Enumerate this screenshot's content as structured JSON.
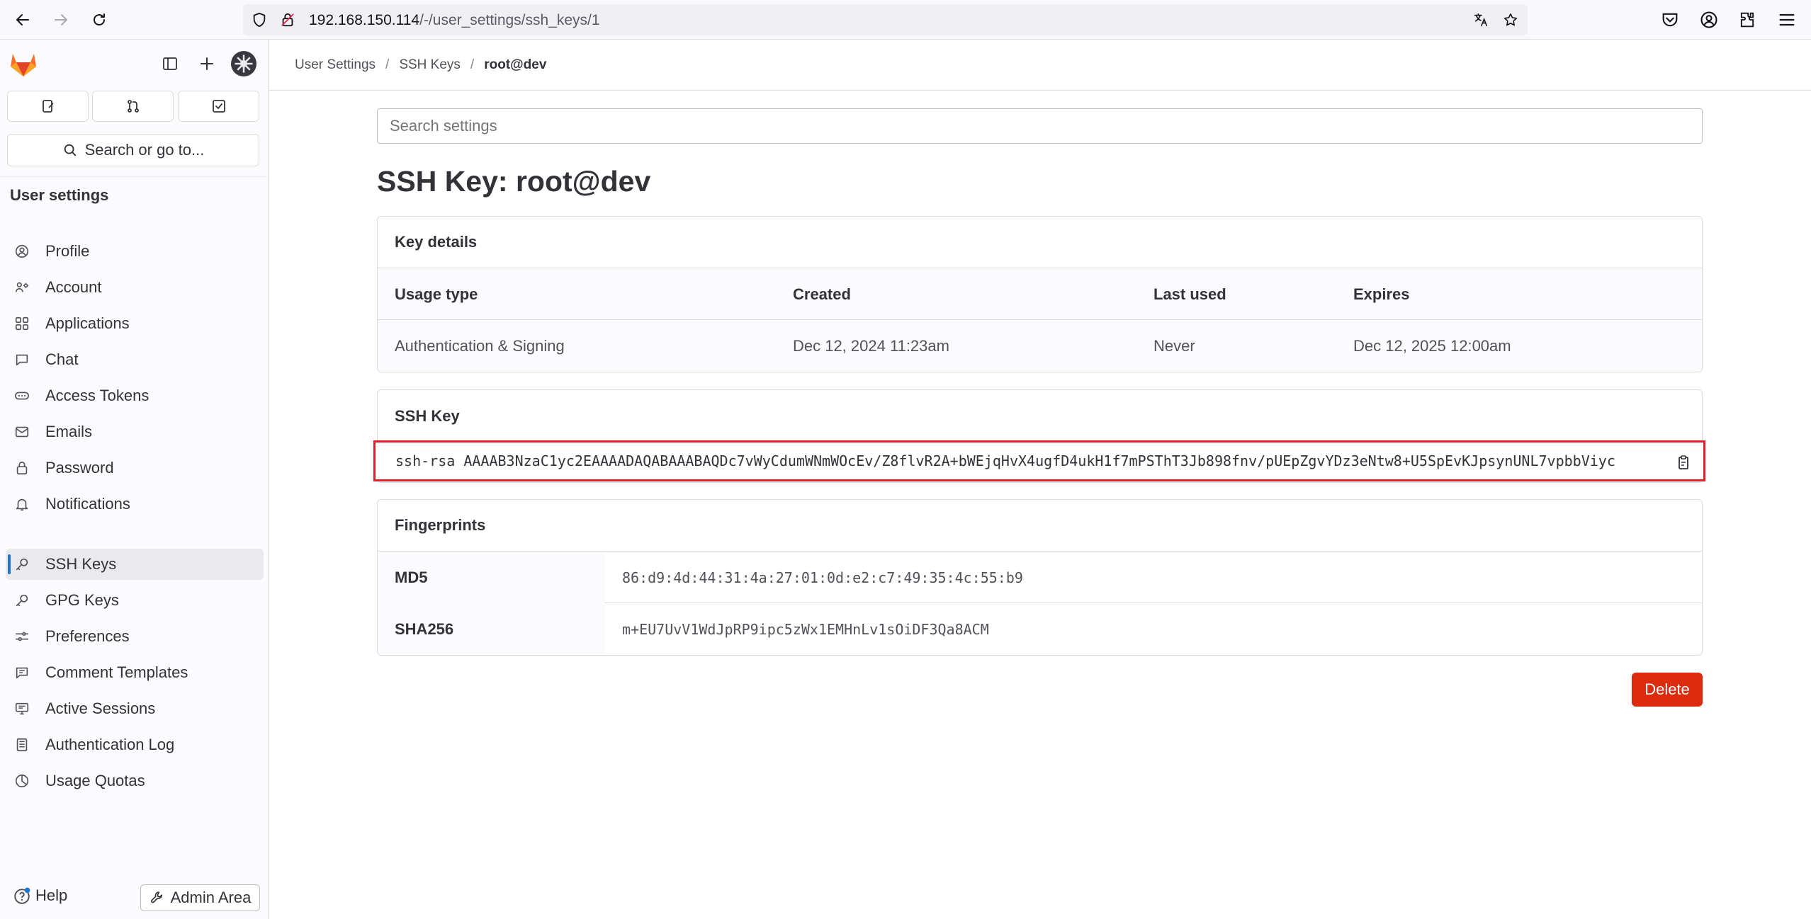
{
  "browser": {
    "url_host": "192.168.150.114",
    "url_path": "/-/user_settings/ssh_keys/1"
  },
  "sidebar": {
    "search_label": "Search or go to...",
    "section_title": "User settings",
    "items": [
      {
        "label": "Profile",
        "icon": "profile-icon"
      },
      {
        "label": "Account",
        "icon": "account-icon"
      },
      {
        "label": "Applications",
        "icon": "applications-icon"
      },
      {
        "label": "Chat",
        "icon": "chat-icon"
      },
      {
        "label": "Access Tokens",
        "icon": "token-icon"
      },
      {
        "label": "Emails",
        "icon": "mail-icon"
      },
      {
        "label": "Password",
        "icon": "lock-icon"
      },
      {
        "label": "Notifications",
        "icon": "bell-icon"
      },
      {
        "label": "SSH Keys",
        "icon": "key-icon",
        "active": true
      },
      {
        "label": "GPG Keys",
        "icon": "key-icon"
      },
      {
        "label": "Preferences",
        "icon": "preferences-icon"
      },
      {
        "label": "Comment Templates",
        "icon": "comment-icon"
      },
      {
        "label": "Active Sessions",
        "icon": "monitor-icon"
      },
      {
        "label": "Authentication Log",
        "icon": "log-icon"
      },
      {
        "label": "Usage Quotas",
        "icon": "quota-icon"
      }
    ],
    "help_label": "Help",
    "admin_label": "Admin Area"
  },
  "breadcrumb": {
    "items": [
      "User Settings",
      "SSH Keys",
      "root@dev"
    ]
  },
  "main": {
    "search_placeholder": "Search settings",
    "title": "SSH Key: root@dev",
    "key_details": {
      "heading": "Key details",
      "columns": [
        "Usage type",
        "Created",
        "Last used",
        "Expires"
      ],
      "values": [
        "Authentication & Signing",
        "Dec 12, 2024 11:23am",
        "Never",
        "Dec 12, 2025 12:00am"
      ]
    },
    "ssh_key": {
      "heading": "SSH Key",
      "value": "ssh-rsa AAAAB3NzaC1yc2EAAAADAQABAAABAQDc7vWyCdumWNmWOcEv/Z8flvR2A+bWEjqHvX4ugfD4ukH1f7mPSThT3Jb898fnv/pUEpZgvYDz3eNtw8+U5SpEvKJpsynUNL7vpbbViyc"
    },
    "fingerprints": {
      "heading": "Fingerprints",
      "rows": [
        {
          "label": "MD5",
          "value": "86:d9:4d:44:31:4a:27:01:0d:e2:c7:49:35:4c:55:b9"
        },
        {
          "label": "SHA256",
          "value": "m+EU7UvV1WdJpRP9ipc5zWx1EMHnLv1sOiDF3Qa8ACM"
        }
      ]
    },
    "delete_label": "Delete"
  },
  "colors": {
    "accent": "#1f75cb",
    "danger": "#dd2b0e",
    "highlight_border": "#e0202a"
  }
}
